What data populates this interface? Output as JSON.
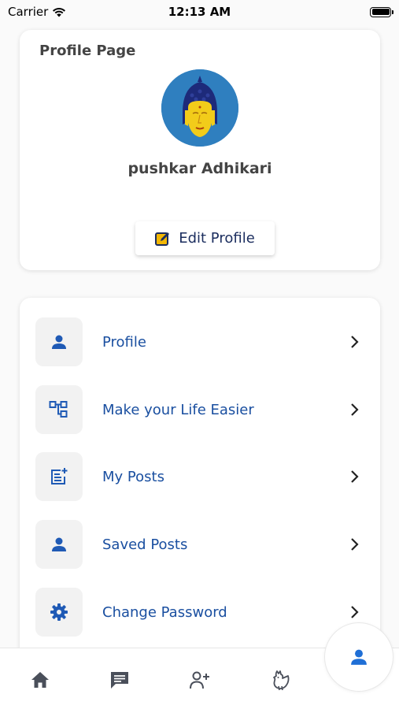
{
  "status_bar": {
    "carrier": "Carrier",
    "time": "12:13 AM"
  },
  "profile": {
    "page_title": "Profile Page",
    "user_name": "pushkar Adhikari",
    "edit_button_label": "Edit Profile"
  },
  "menu": {
    "items": [
      {
        "label": "Profile",
        "icon": "person-icon"
      },
      {
        "label": "Make your Life Easier",
        "icon": "hierarchy-icon"
      },
      {
        "label": "My Posts",
        "icon": "post-add-icon"
      },
      {
        "label": "Saved Posts",
        "icon": "person-icon"
      },
      {
        "label": "Change Password",
        "icon": "gear-icon"
      }
    ]
  },
  "bottom_nav": {
    "tabs": [
      "home-icon",
      "chat-icon",
      "add-user-icon",
      "rooster-icon",
      "profile-icon"
    ]
  },
  "colors": {
    "accent": "#1a4fa0",
    "icon_blue": "#1f5ab5",
    "edit_icon": "#f2b705",
    "text_dark": "#444444"
  }
}
